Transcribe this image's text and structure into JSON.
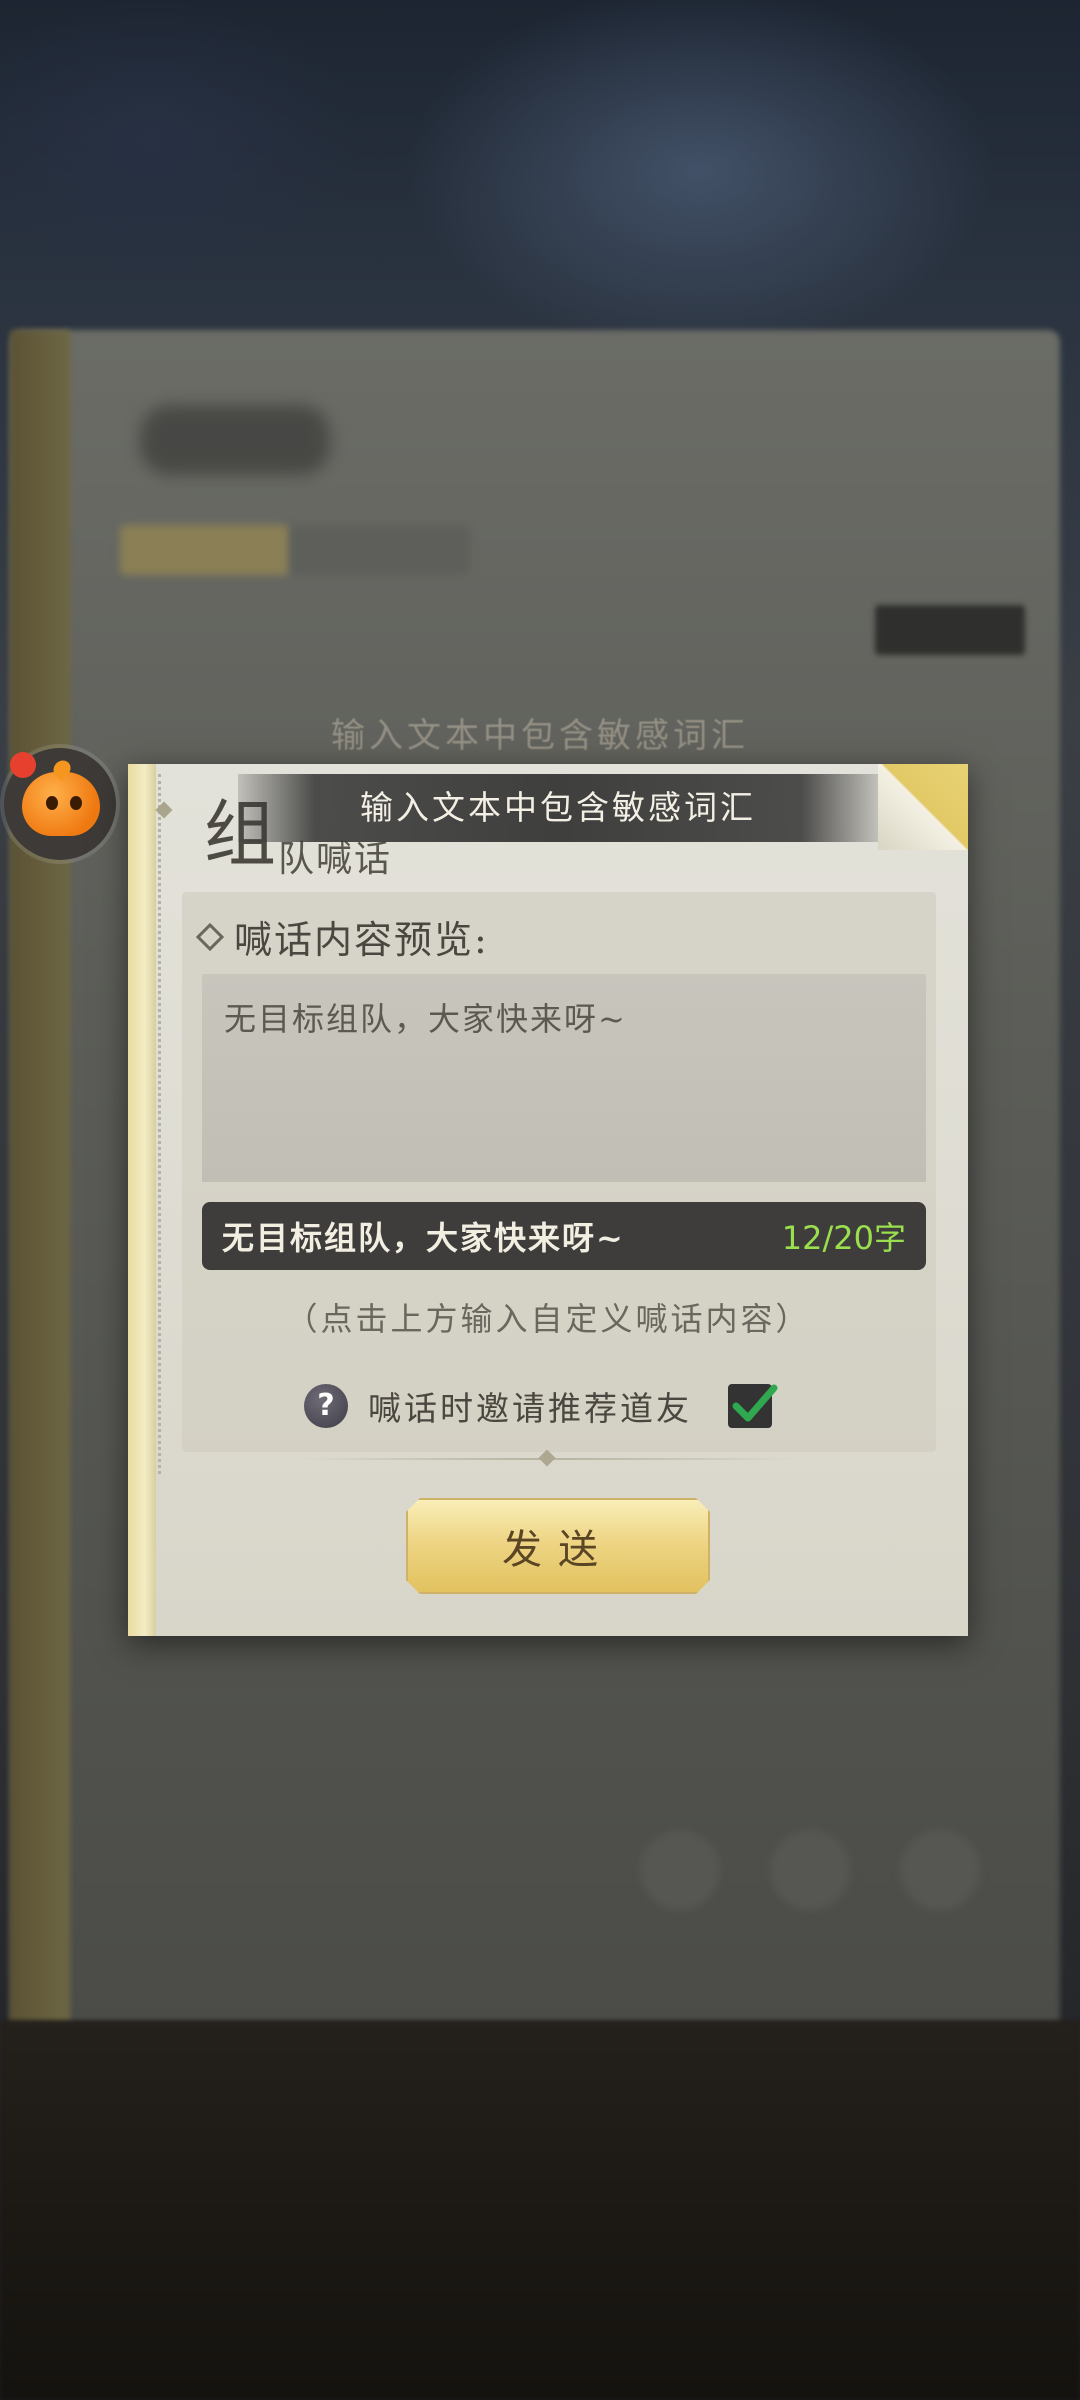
{
  "background": {
    "ghost_toast": "输入文本中包含敏感词汇"
  },
  "floating_assistant": {
    "icon": "orange-mascot-icon",
    "badge_color": "#e8402e"
  },
  "dialog": {
    "toast_message": "输入文本中包含敏感词汇",
    "title_first_char": "组",
    "title_rest": "队喊话",
    "preview_label": "喊话内容预览:",
    "preview_text": "无目标组队，大家快来呀~",
    "input_value": "无目标组队，大家快来呀~",
    "char_count": "12/20字",
    "hint": "（点击上方输入自定义喊话内容）",
    "invite_label": "喊话时邀请推荐道友",
    "invite_checked": true,
    "send_label": "发送"
  },
  "colors": {
    "char_count": "#9adf4e",
    "send_button": "#eed585",
    "checkmark": "#2fa84f"
  }
}
